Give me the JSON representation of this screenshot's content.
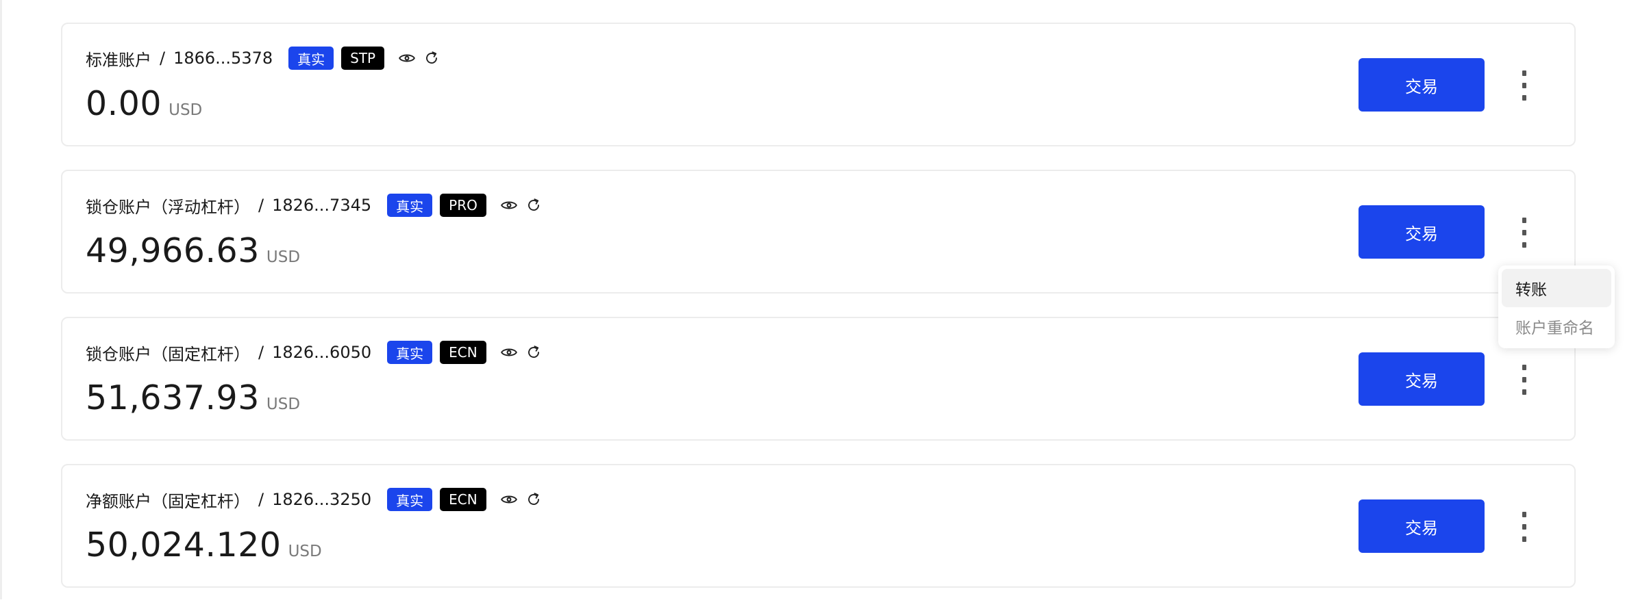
{
  "accounts": [
    {
      "name": "标准账户",
      "separator": "/",
      "number": "1866...5378",
      "real_badge": "真实",
      "type_badge": "STP",
      "balance": "0.00",
      "currency": "USD",
      "trade_label": "交易"
    },
    {
      "name": "锁仓账户（浮动杠杆）",
      "separator": "/",
      "number": "1826...7345",
      "real_badge": "真实",
      "type_badge": "PRO",
      "balance": "49,966.63",
      "currency": "USD",
      "trade_label": "交易"
    },
    {
      "name": "锁仓账户（固定杠杆）",
      "separator": "/",
      "number": "1826...6050",
      "real_badge": "真实",
      "type_badge": "ECN",
      "balance": "51,637.93",
      "currency": "USD",
      "trade_label": "交易"
    },
    {
      "name": "净额账户（固定杠杆）",
      "separator": "/",
      "number": "1826...3250",
      "real_badge": "真实",
      "type_badge": "ECN",
      "balance": "50,024.120",
      "currency": "USD",
      "trade_label": "交易"
    }
  ],
  "dropdown": {
    "items": [
      "转账",
      "账户重命名"
    ]
  },
  "icons": {
    "visibility": "eye-icon",
    "refresh": "refresh-icon",
    "more": "more-vertical-icon"
  },
  "colors": {
    "primary": "#1b45ec",
    "badge_type": "#000000",
    "border": "#ececec",
    "muted_text": "#7a7a7a"
  }
}
